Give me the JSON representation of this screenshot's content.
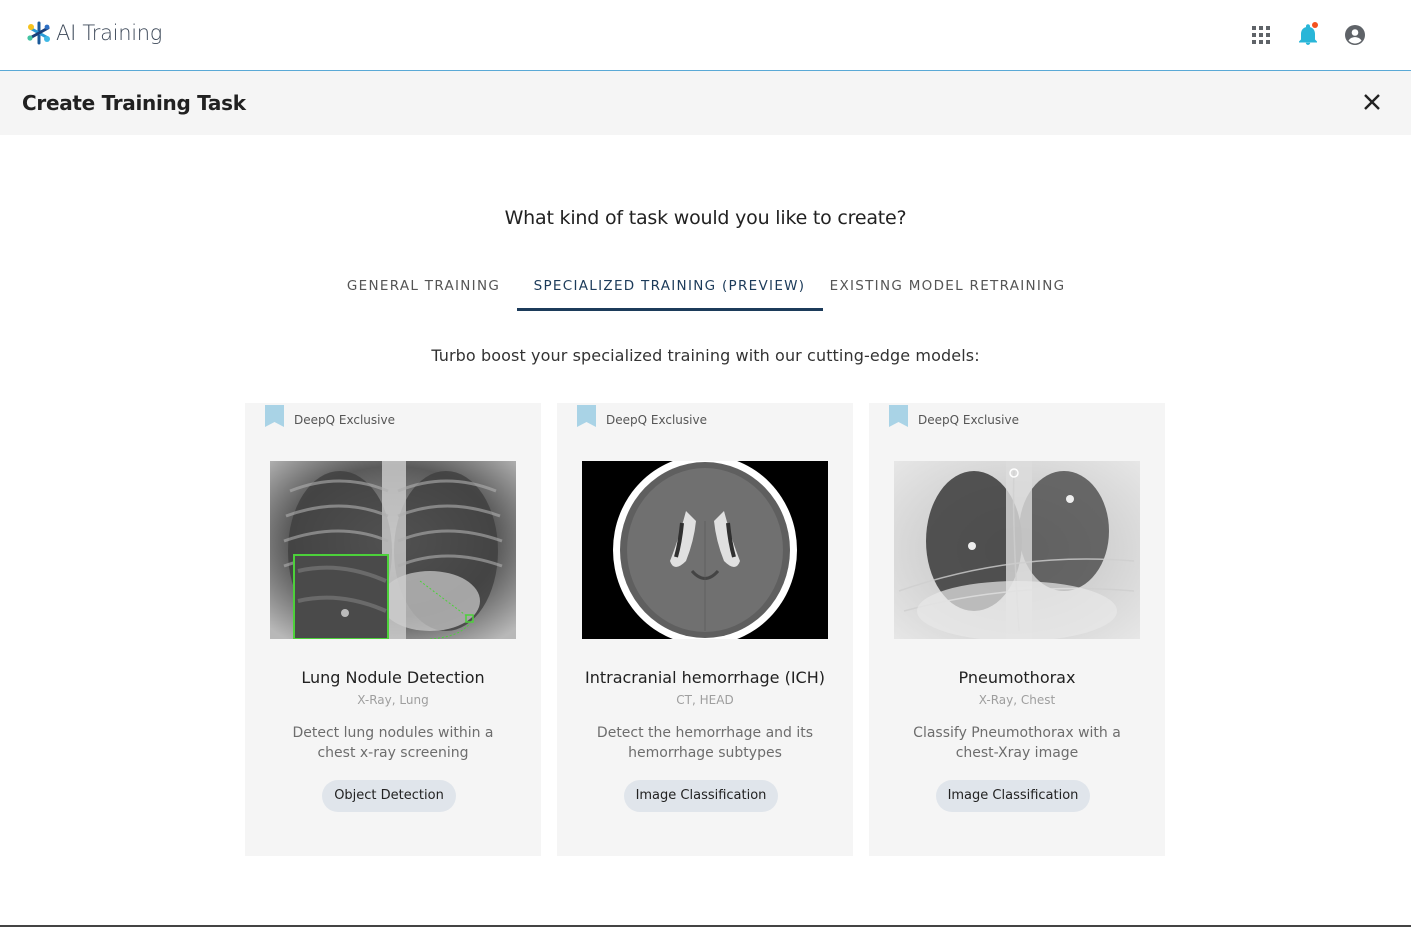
{
  "app": {
    "name": "AI Training"
  },
  "header": {
    "icons": [
      "apps-grid-icon",
      "bell-icon",
      "account-icon"
    ]
  },
  "subheader": {
    "title": "Create Training Task"
  },
  "main": {
    "question": "What kind of task would you like to create?",
    "tabs": [
      {
        "label": "GENERAL TRAINING",
        "active": false
      },
      {
        "label": "SPECIALIZED TRAINING (PREVIEW)",
        "active": true
      },
      {
        "label": "EXISTING MODEL RETRAINING",
        "active": false
      }
    ],
    "subtitle": "Turbo boost your specialized training with our cutting-edge models:",
    "cards": [
      {
        "badge": "DeepQ Exclusive",
        "title": "Lung Nodule Detection",
        "meta": "X-Ray, Lung",
        "desc": "Detect lung nodules within a chest x-ray screening",
        "chip": "Object Detection"
      },
      {
        "badge": "DeepQ Exclusive",
        "title": "Intracranial hemorrhage (ICH)",
        "meta": "CT, HEAD",
        "desc": "Detect the hemorrhage and its hemorrhage subtypes",
        "chip": "Image Classification"
      },
      {
        "badge": "DeepQ Exclusive",
        "title": "Pneumothorax",
        "meta": "X-Ray, Chest",
        "desc": "Classify Pneumothorax with a chest-Xray image",
        "chip": "Image Classification"
      }
    ]
  },
  "colors": {
    "accent": "#1c3b5a",
    "notification_dot": "#f4511e",
    "bell": "#29b6d8",
    "ribbon": "#a9d3e6",
    "nodule_box": "#4cd13a"
  }
}
